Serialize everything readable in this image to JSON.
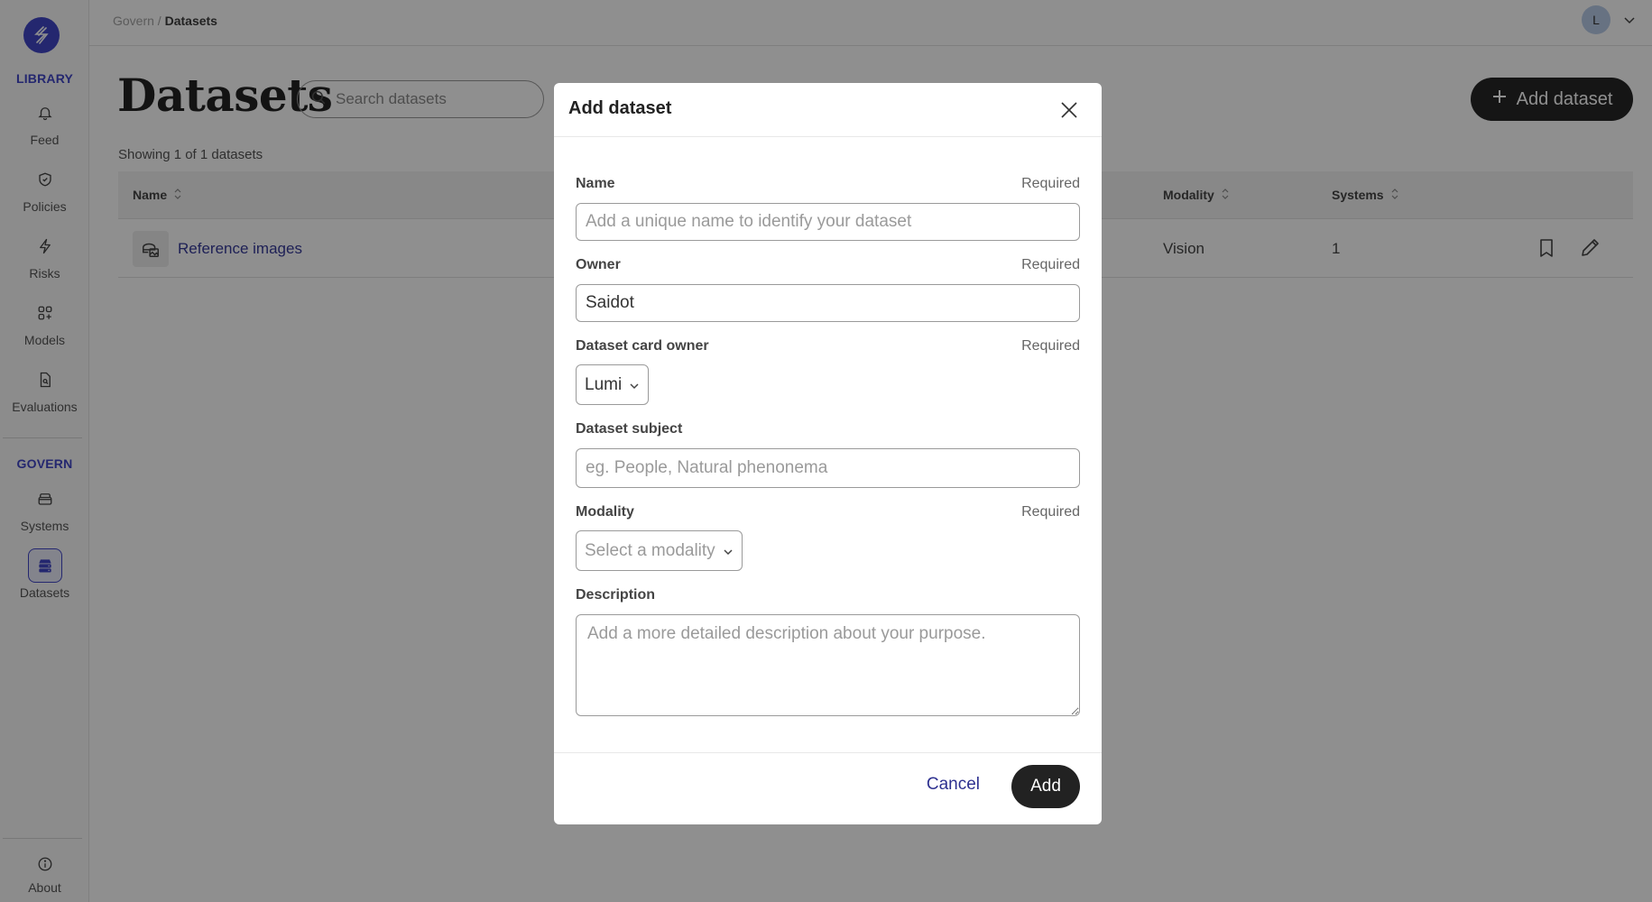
{
  "sidebar": {
    "sections": [
      {
        "label": "LIBRARY"
      },
      {
        "label": "GOVERN"
      }
    ],
    "items": [
      {
        "label": "Feed",
        "icon": "bell-icon"
      },
      {
        "label": "Policies",
        "icon": "shield-check-icon"
      },
      {
        "label": "Risks",
        "icon": "lightning-icon"
      },
      {
        "label": "Models",
        "icon": "grid-plus-icon"
      },
      {
        "label": "Evaluations",
        "icon": "document-search-icon"
      },
      {
        "label": "Systems",
        "icon": "archive-icon"
      },
      {
        "label": "Datasets",
        "icon": "database-icon",
        "active": true
      }
    ],
    "about": {
      "label": "About",
      "icon": "info-icon"
    }
  },
  "header": {
    "breadcrumb": {
      "parent": "Govern",
      "separator": " / ",
      "current": "Datasets"
    },
    "avatar_initial": "L"
  },
  "main": {
    "title": "Datasets",
    "search_placeholder": "Search datasets",
    "add_button_label": "Add dataset",
    "showing_text": "Showing 1 of 1 datasets",
    "table": {
      "columns": [
        "Name",
        "Modality",
        "Systems"
      ],
      "rows": [
        {
          "name": "Reference images",
          "modality": "Vision",
          "systems": "1"
        }
      ]
    }
  },
  "modal": {
    "title": "Add dataset",
    "required_text": "Required",
    "fields": {
      "name": {
        "label": "Name",
        "placeholder": "Add a unique name to identify your dataset",
        "value": ""
      },
      "owner": {
        "label": "Owner",
        "value": "Saidot"
      },
      "card_owner": {
        "label": "Dataset card owner",
        "value": "Lumi"
      },
      "subject": {
        "label": "Dataset subject",
        "placeholder": "eg. People, Natural phenonema",
        "value": ""
      },
      "modality": {
        "label": "Modality",
        "placeholder": "Select a modality"
      },
      "description": {
        "label": "Description",
        "placeholder": "Add a more detailed description about your purpose."
      }
    },
    "cancel_label": "Cancel",
    "submit_label": "Add"
  },
  "colors": {
    "brand": "#4147c7",
    "primary_button": "#262626",
    "link": "#363a9a"
  }
}
